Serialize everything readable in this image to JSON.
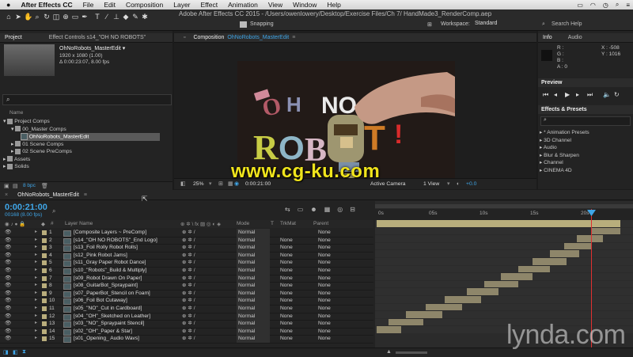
{
  "menubar": {
    "apple": "",
    "items": [
      "After Effects CC",
      "File",
      "Edit",
      "Composition",
      "Layer",
      "Effect",
      "Animation",
      "View",
      "Window",
      "Help"
    ],
    "right_icons": [
      "battery-icon",
      "wifi-icon",
      "clock-icon",
      "search-icon",
      "list-icon"
    ]
  },
  "toolbar": {
    "window_title": "Adobe After Effects CC 2015 - /Users/owenlowery/Desktop/Exercise Files/Ch 7/ HandMade3_RenderComp.aep",
    "snapping": "Snapping",
    "workspace_label": "Workspace:",
    "workspace_value": "Standard",
    "search_help": "Search Help"
  },
  "project_panel": {
    "tab_project": "Project",
    "tab_effect_controls": "Effect Controls s14_\"OH NO ROBOTS\"",
    "comp_name": "OhNoRobots_MasterEdit ▾",
    "comp_size": "1920 x 1080 (1.00)",
    "comp_duration": "Δ 0:00:23:07, 8.00 fps",
    "col_name": "Name",
    "tree": [
      {
        "label": "Project Comps",
        "level": 0
      },
      {
        "label": "00_Master Comps",
        "level": 1
      },
      {
        "label": "OhNoRobots_MasterEdit",
        "level": 2,
        "selected": true
      },
      {
        "label": "01 Scene Comps",
        "level": 1
      },
      {
        "label": "02 Scene PreComps",
        "level": 1
      },
      {
        "label": "Assets",
        "level": 0
      },
      {
        "label": "Solids",
        "level": 0
      }
    ],
    "bpc": "8 bpc"
  },
  "comp_panel": {
    "tab_label": "Composition",
    "comp_name": "OhNoRobots_MasterEdit",
    "zoom": "25%",
    "timecode": "0:00:21:00",
    "camera": "Active Camera",
    "views": "1 View",
    "exposure": "+0.0"
  },
  "info_panel": {
    "tab_info": "Info",
    "tab_audio": "Audio",
    "r": "R :",
    "g": "G :",
    "b": "B :",
    "a": "A : 0",
    "x": "X : -508",
    "y": "Y : 1016"
  },
  "preview_panel": {
    "title": "Preview"
  },
  "effects_panel": {
    "title": "Effects & Presets",
    "items": [
      "* Animation Presets",
      "3D Channel",
      "Audio",
      "Blur & Sharpen",
      "Channel",
      "CINEMA 4D"
    ]
  },
  "timeline": {
    "tab": "OhNoRobots_MasterEdit",
    "timecode": "0:00:21:00",
    "frame_info": "00168 (8.00 fps)",
    "col_layer_name": "Layer Name",
    "col_mode": "Mode",
    "col_t": "T",
    "col_trkmat": "TrkMat",
    "col_parent": "Parent",
    "ruler": [
      "0s",
      "05s",
      "10s",
      "15s",
      "20s"
    ],
    "layers": [
      {
        "num": "1",
        "name": "[Composite Layers ~ PreComp]",
        "mode": "Normal",
        "trkmat": "",
        "parent": "None",
        "start": 0.0,
        "end": 1.0
      },
      {
        "num": "2",
        "name": "[s14_\"OH NO ROBOTS\"_End Logo]",
        "mode": "Normal",
        "trkmat": "None",
        "parent": "None",
        "start": 0.88,
        "end": 1.0
      },
      {
        "num": "3",
        "name": "[s13_Foil Rolly Robot Rolls]",
        "mode": "Normal",
        "trkmat": "None",
        "parent": "None",
        "start": 0.82,
        "end": 0.93
      },
      {
        "num": "4",
        "name": "[s12_Pink Robot Jams]",
        "mode": "Normal",
        "trkmat": "None",
        "parent": "None",
        "start": 0.77,
        "end": 0.88
      },
      {
        "num": "5",
        "name": "[s11_Gray Paper Robot Dance]",
        "mode": "Normal",
        "trkmat": "None",
        "parent": "None",
        "start": 0.71,
        "end": 0.83
      },
      {
        "num": "6",
        "name": "[s10_\"Robots\"_Build & Multiply]",
        "mode": "Normal",
        "trkmat": "None",
        "parent": "None",
        "start": 0.64,
        "end": 0.78
      },
      {
        "num": "7",
        "name": "[s09_Robot Drawn On Paper]",
        "mode": "Normal",
        "trkmat": "None",
        "parent": "None",
        "start": 0.58,
        "end": 0.71
      },
      {
        "num": "8",
        "name": "[s08_GuitarBot_Spraypaint]",
        "mode": "Normal",
        "trkmat": "None",
        "parent": "None",
        "start": 0.51,
        "end": 0.64
      },
      {
        "num": "9",
        "name": "[s07_PaperBot_Stencil on Foam]",
        "mode": "Normal",
        "trkmat": "None",
        "parent": "None",
        "start": 0.44,
        "end": 0.58
      },
      {
        "num": "10",
        "name": "[s06_Foil Bot Cutaway]",
        "mode": "Normal",
        "trkmat": "None",
        "parent": "None",
        "start": 0.37,
        "end": 0.5
      },
      {
        "num": "11",
        "name": "[s05_\"NO\"_Cut in Cardboard]",
        "mode": "Normal",
        "trkmat": "None",
        "parent": "None",
        "start": 0.28,
        "end": 0.43
      },
      {
        "num": "12",
        "name": "[s04_\"OH\"_Sketched on Leather]",
        "mode": "Normal",
        "trkmat": "None",
        "parent": "None",
        "start": 0.2,
        "end": 0.35
      },
      {
        "num": "13",
        "name": "[s03_\"NO\"_Spraypaint Stencil]",
        "mode": "Normal",
        "trkmat": "None",
        "parent": "None",
        "start": 0.12,
        "end": 0.27
      },
      {
        "num": "14",
        "name": "[s02_\"OH\"_Paper & Star]",
        "mode": "Normal",
        "trkmat": "None",
        "parent": "None",
        "start": 0.05,
        "end": 0.19
      },
      {
        "num": "15",
        "name": "[s01_Opening_ Audio Wavs]",
        "mode": "Normal",
        "trkmat": "None",
        "parent": "None",
        "start": 0.0,
        "end": 0.1
      }
    ]
  },
  "watermarks": {
    "cgku": "www.cg-ku.com",
    "lynda": "lynda.com"
  },
  "colors": {
    "accent_blue": "#3fa6e8",
    "playhead_red": "#e03030",
    "track_tan": "#8e866a",
    "watermark_yellow": "#f0e41c"
  }
}
